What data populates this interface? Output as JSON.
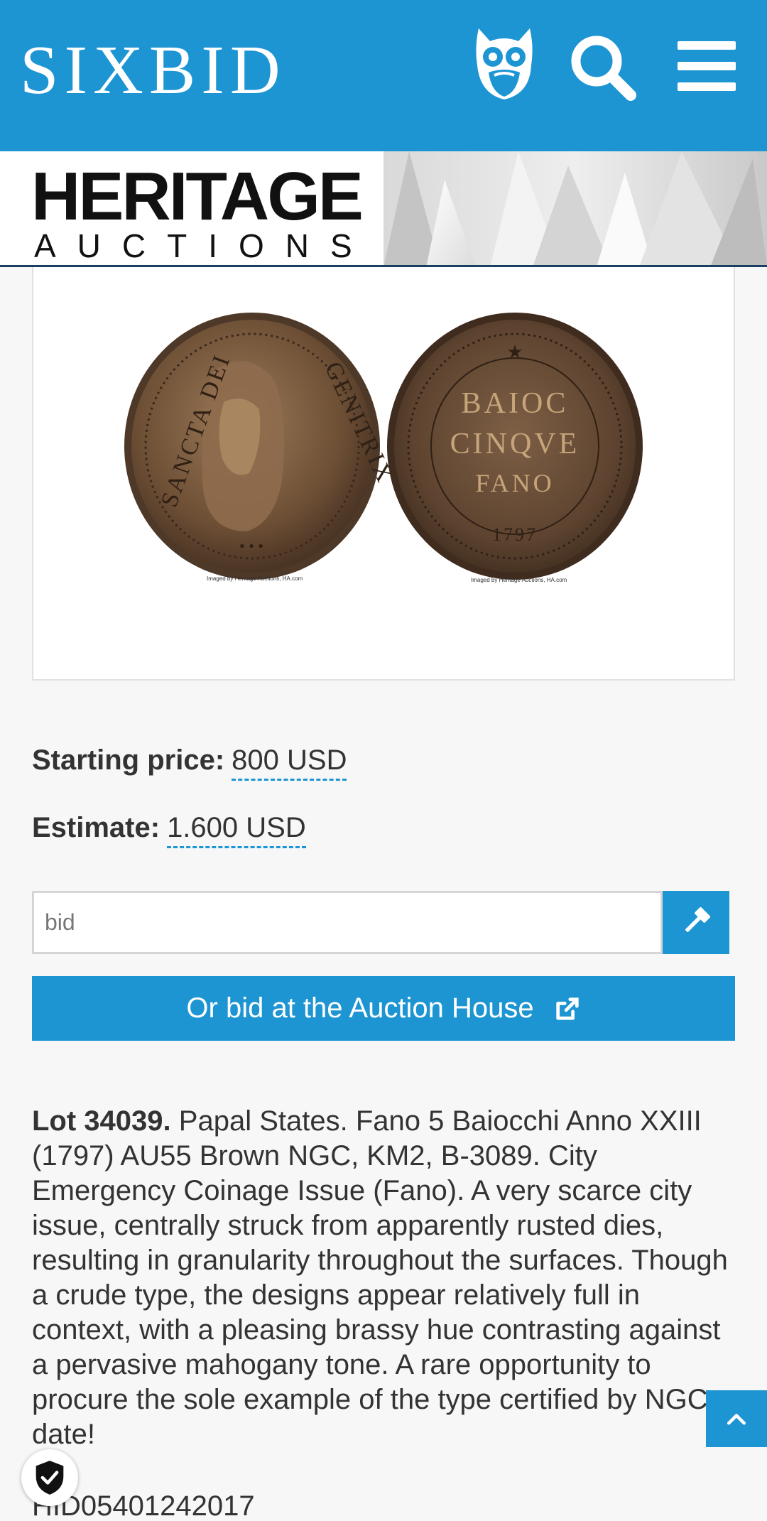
{
  "header": {
    "brand": "SIXBID",
    "owl_icon": "owl-icon",
    "search_icon": "search-icon",
    "menu_icon": "hamburger-menu-icon",
    "background_color": "#1d95d3"
  },
  "auction_house": {
    "logo_line1": "HERITAGE",
    "logo_line2": "AUCTIONS"
  },
  "lot_image": {
    "credit_left": "Imaged by Heritage Auctions, HA.com",
    "credit_right": "Imaged by Heritage Auctions, HA.com"
  },
  "pricing": {
    "starting_label": "Starting price:",
    "starting_value": "800 USD",
    "estimate_label": "Estimate:",
    "estimate_value": "1.600 USD"
  },
  "bid": {
    "placeholder": "bid",
    "submit_icon": "gavel-icon",
    "house_button_label": "Or bid at the Auction House",
    "house_button_icon": "external-link-icon"
  },
  "description": {
    "lot_label": "Lot 34039.",
    "text": "Papal States. Fano 5 Baiocchi Anno XXIII (1797) AU55 Brown NGC, KM2, B-3089. City Emergency Coinage Issue (Fano). A very scarce city issue, centrally struck from apparently rusted dies, resulting in granularity throughout the surfaces. Though a crude type, the designs appear relatively full in context, with a pleasing brassy hue contrasting against a pervasive mahogany tone. A rare opportunity to procure the sole example of the type certified by NGC to date!",
    "hid": "HID05401242017"
  },
  "controls": {
    "scroll_top_icon": "chevron-up-icon",
    "badge_icon": "shield-check-icon"
  }
}
